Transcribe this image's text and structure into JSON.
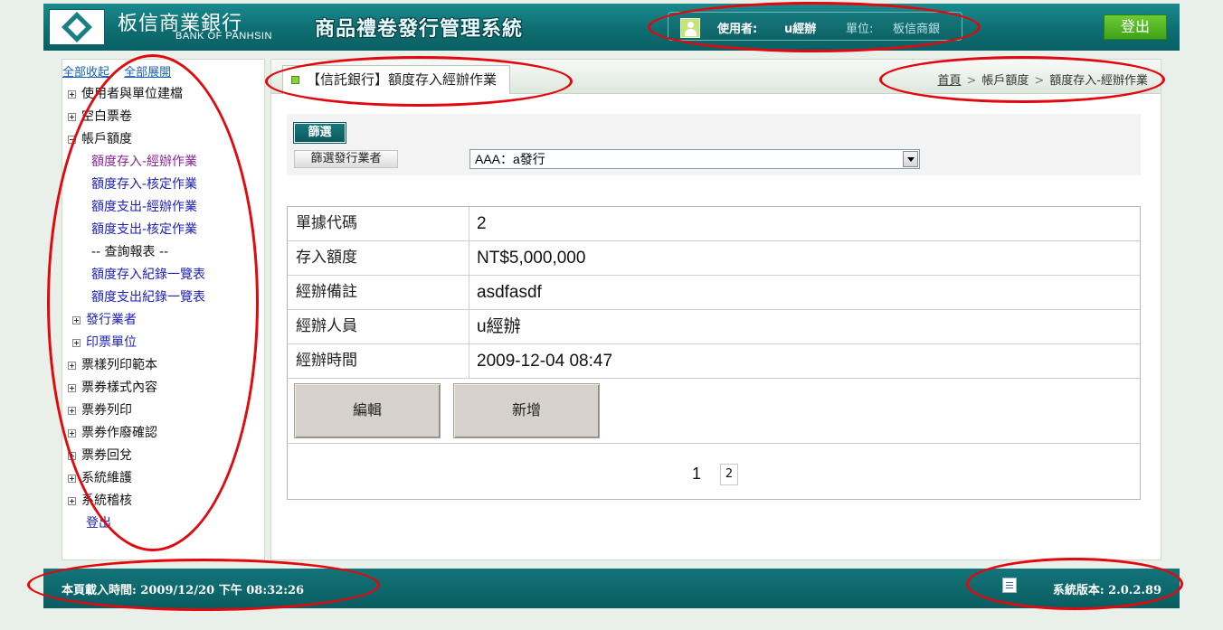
{
  "header": {
    "bank_name": "板信商業銀行",
    "bank_name_en": "BANK OF PANHSIN",
    "system_title": "商品禮卷發行管理系統",
    "user_label": "使用者:",
    "user_name": "u經辦",
    "unit_label": "單位:",
    "unit_name": "板信商銀",
    "logout_label": "登出"
  },
  "sidebar": {
    "collapse_all": "全部收起",
    "expand_all": "全部展開",
    "items": [
      {
        "label": "使用者與單位建檔"
      },
      {
        "label": "空白票卷"
      },
      {
        "label": "帳戶額度"
      },
      {
        "label": "額度存入-經辦作業"
      },
      {
        "label": "額度存入-核定作業"
      },
      {
        "label": "額度支出-經辦作業"
      },
      {
        "label": "額度支出-核定作業"
      },
      {
        "label": "-- 查詢報表 --"
      },
      {
        "label": "額度存入紀錄一覽表"
      },
      {
        "label": "額度支出紀錄一覽表"
      },
      {
        "label": "發行業者"
      },
      {
        "label": "印票單位"
      },
      {
        "label": "票樣列印範本"
      },
      {
        "label": "票券樣式內容"
      },
      {
        "label": "票券列印"
      },
      {
        "label": "票券作廢確認"
      },
      {
        "label": "票券回兌"
      },
      {
        "label": "系統維護"
      },
      {
        "label": "系統稽核"
      },
      {
        "label": "登出"
      }
    ]
  },
  "main": {
    "title": "【信託銀行】額度存入經辦作業",
    "breadcrumb": {
      "home": "首頁",
      "level1": "帳戶額度",
      "level2": "額度存入-經辦作業",
      "separator": ">"
    },
    "filter": {
      "badge": "篩選",
      "label": "篩選發行業者",
      "selected": "AAA：a發行"
    },
    "detail": [
      {
        "key": "單據代碼",
        "value": "2"
      },
      {
        "key": "存入額度",
        "value": "NT$5,000,000"
      },
      {
        "key": "經辦備註",
        "value": "asdfasdf"
      },
      {
        "key": "經辦人員",
        "value": "u經辦"
      },
      {
        "key": "經辦時間",
        "value": "2009-12-04 08:47"
      }
    ],
    "actions": {
      "edit": "編輯",
      "add": "新增"
    },
    "pager": {
      "current": "1",
      "next": "2"
    }
  },
  "footer": {
    "load_time": "本頁載入時間: 2009/12/20 下午 08:32:26",
    "version": "系統版本: 2.0.2.89"
  },
  "colors": {
    "header_teal": "#0d6e72",
    "logout_green": "#4cb320",
    "annotation_red": "#e3080d",
    "link_blue": "#1f22b5",
    "current_purple": "#8a2595"
  }
}
